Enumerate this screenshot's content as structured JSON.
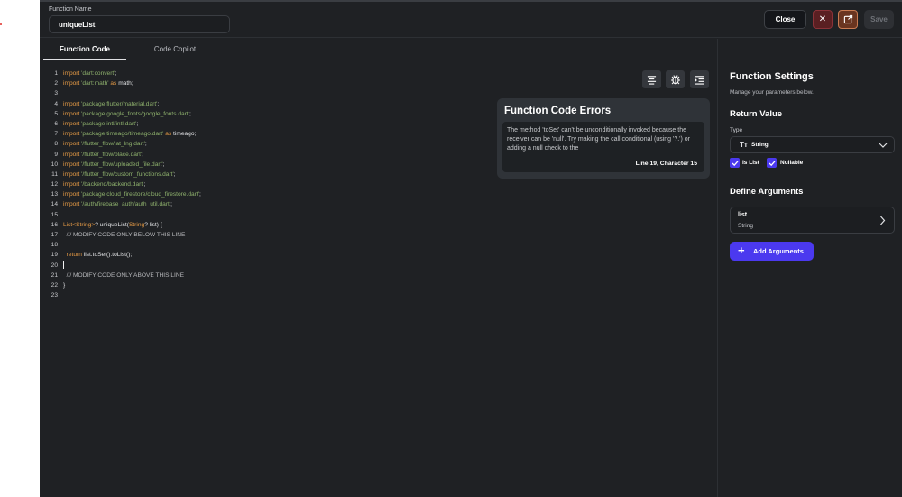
{
  "header": {
    "function_name_label": "Function Name",
    "function_name_value": "uniqueList",
    "close_label": "Close",
    "close_x_icon": "x-icon",
    "open_external_icon": "open-external-icon",
    "save_label": "Save"
  },
  "tabs": [
    {
      "label": "Function Code",
      "active": true
    },
    {
      "label": "Code Copilot",
      "active": false
    }
  ],
  "toolbar": {
    "format_icon": "align-center-icon",
    "debug_icon": "bug-icon",
    "outline_icon": "indent-list-icon"
  },
  "code": {
    "lines": [
      {
        "n": "1",
        "text": "import 'dart:convert';"
      },
      {
        "n": "2",
        "text": "import 'dart:math' as math;"
      },
      {
        "n": "3",
        "text": ""
      },
      {
        "n": "4",
        "text": "import 'package:flutter/material.dart';"
      },
      {
        "n": "5",
        "text": "import 'package:google_fonts/google_fonts.dart';"
      },
      {
        "n": "6",
        "text": "import 'package:intl/intl.dart';"
      },
      {
        "n": "7",
        "text": "import 'package:timeago/timeago.dart' as timeago;"
      },
      {
        "n": "8",
        "text": "import '/flutter_flow/lat_lng.dart';"
      },
      {
        "n": "9",
        "text": "import '/flutter_flow/place.dart';"
      },
      {
        "n": "10",
        "text": "import '/flutter_flow/uploaded_file.dart';"
      },
      {
        "n": "11",
        "text": "import '/flutter_flow/custom_functions.dart';"
      },
      {
        "n": "12",
        "text": "import '/backend/backend.dart';"
      },
      {
        "n": "13",
        "text": "import 'package:cloud_firestore/cloud_firestore.dart';"
      },
      {
        "n": "14",
        "text": "import '/auth/firebase_auth/auth_util.dart';"
      },
      {
        "n": "15",
        "text": ""
      },
      {
        "n": "16",
        "text": "List<String>? uniqueList(String? list) {"
      },
      {
        "n": "17",
        "text": "  /// MODIFY CODE ONLY BELOW THIS LINE"
      },
      {
        "n": "18",
        "text": ""
      },
      {
        "n": "19",
        "text": "  return list.toSet().toList();"
      },
      {
        "n": "20",
        "text": ""
      },
      {
        "n": "21",
        "text": "  /// MODIFY CODE ONLY ABOVE THIS LINE"
      },
      {
        "n": "22",
        "text": "}"
      },
      {
        "n": "23",
        "text": ""
      }
    ]
  },
  "errors": {
    "title": "Function Code Errors",
    "message": "The method 'toSet' can't be unconditionally invoked because the receiver can be 'null'. Try making the call conditional (using '?.') or adding a null check to the",
    "location": "Line 19, Character 15"
  },
  "settings": {
    "title": "Function Settings",
    "subtitle": "Manage your parameters below.",
    "return_value_heading": "Return Value",
    "type_label": "Type",
    "type_icon": "Tт",
    "type_value": "String",
    "is_list_label": "Is List",
    "is_list_checked": true,
    "nullable_label": "Nullable",
    "nullable_checked": true,
    "define_arguments_heading": "Define Arguments",
    "arguments": [
      {
        "name": "list",
        "type": "String"
      }
    ],
    "add_arguments_label": "Add Arguments",
    "accent_color": "#4b39ef"
  }
}
